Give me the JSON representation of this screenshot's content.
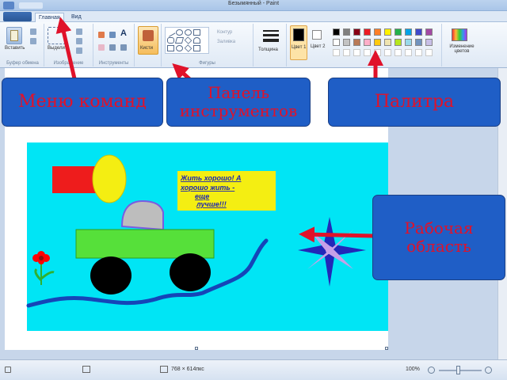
{
  "window": {
    "title": "Безымянный - Paint"
  },
  "tabs": [
    {
      "label": "Главная"
    },
    {
      "label": "Вид"
    }
  ],
  "ribbon": {
    "paste_label": "Вставить",
    "select_label": "Выделить",
    "brushes_label": "Кисти",
    "outline_label": "Контур",
    "fill_label": "Заливка",
    "size_label": "Толщина",
    "color1_label": "Цвет 1",
    "color2_label": "Цвет 2",
    "edit_colors_label": "Изменение цветов",
    "groups": {
      "clipboard": "Буфер обмена",
      "image": "Изображение",
      "tools": "Инструменты",
      "shapes": "Фигуры"
    }
  },
  "palette": {
    "colors": [
      "#000000",
      "#7f7f7f",
      "#880015",
      "#ed1c24",
      "#ff7f27",
      "#fff200",
      "#22b14c",
      "#00a2e8",
      "#3f48cc",
      "#a349a4",
      "#ffffff",
      "#c3c3c3",
      "#b97a57",
      "#ffaec9",
      "#ffc90e",
      "#efe4b0",
      "#b5e61d",
      "#99d9ea",
      "#7092be",
      "#c8bfe7"
    ],
    "color1": "#000000",
    "color2": "#ffffff"
  },
  "drawing": {
    "caption": "Жить хорошо! А хорошо жить - еще лучше!!!",
    "background": "#00e5f5"
  },
  "status": {
    "dimensions": "768 × 614пкс",
    "zoom": "100%"
  },
  "callouts": {
    "menu": "Меню команд",
    "tools_panel": "Панель инструментов",
    "palette": "Палитра",
    "work_area": "Рабочая область"
  }
}
